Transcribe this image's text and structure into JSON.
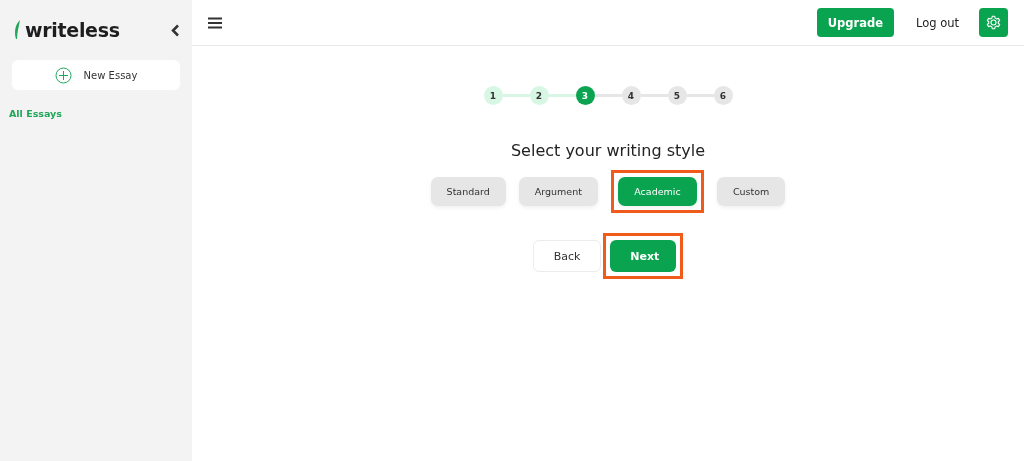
{
  "sidebar": {
    "logo": "writeless",
    "new_button": "New Essay",
    "items": [
      {
        "label": "All Essays",
        "selected": true
      }
    ]
  },
  "header": {
    "upgrade": "Upgrade",
    "logout": "Log out"
  },
  "steps": [
    {
      "label": "1",
      "completed": true,
      "selected": false
    },
    {
      "label": "2",
      "completed": true,
      "selected": false
    },
    {
      "label": "3",
      "completed": false,
      "selected": true
    },
    {
      "label": "4",
      "completed": false,
      "selected": false
    },
    {
      "label": "5",
      "completed": false,
      "selected": false
    },
    {
      "label": "6",
      "completed": false,
      "selected": false
    }
  ],
  "title": "Select your writing style",
  "styles": [
    {
      "label": "Standard",
      "selected": false,
      "highlighted": false
    },
    {
      "label": "Argument",
      "selected": false,
      "highlighted": false
    },
    {
      "label": "Academic",
      "selected": true,
      "highlighted": true
    },
    {
      "label": "Custom",
      "selected": false,
      "highlighted": false
    }
  ],
  "actions": [
    {
      "label": "Back",
      "kind": "secondary",
      "highlighted": false
    },
    {
      "label": "Next",
      "kind": "primary",
      "highlighted": true
    }
  ]
}
